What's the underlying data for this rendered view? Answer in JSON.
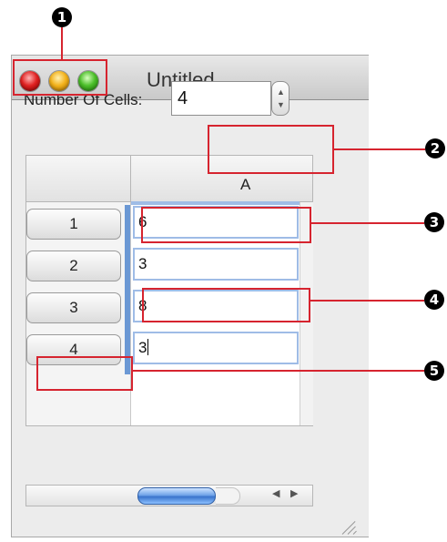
{
  "window": {
    "title": "Untitled"
  },
  "form": {
    "cells_label": "Number Of Cells:",
    "cells_value": "4"
  },
  "table": {
    "column_header": "A",
    "rows": [
      {
        "header": "1",
        "value": "6"
      },
      {
        "header": "2",
        "value": "3"
      },
      {
        "header": "3",
        "value": "8"
      },
      {
        "header": "4",
        "value": "3"
      }
    ]
  },
  "callouts": [
    "1",
    "2",
    "3",
    "4",
    "5"
  ],
  "colors": {
    "annotation_red": "#d6242f",
    "selection_blue": "#6b98d4"
  },
  "icons": [
    "close-icon",
    "minimize-icon",
    "zoom-icon",
    "stepper-up-icon",
    "stepper-down-icon",
    "scroll-left-icon",
    "scroll-right-icon",
    "resize-grip-icon"
  ]
}
